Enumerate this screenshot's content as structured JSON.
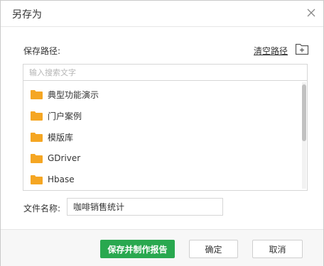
{
  "dialog": {
    "title": "另存为",
    "close_icon": "close-icon"
  },
  "path": {
    "label": "保存路径:",
    "clear_link": "清空路径",
    "new_folder_icon": "new-folder-icon"
  },
  "search": {
    "placeholder": "输入搜索文字",
    "value": ""
  },
  "folders": [
    {
      "label": "典型功能演示",
      "icon": "folder-icon"
    },
    {
      "label": "门户案例",
      "icon": "folder-icon"
    },
    {
      "label": "模版库",
      "icon": "folder-icon"
    },
    {
      "label": "GDriver",
      "icon": "folder-icon"
    },
    {
      "label": "Hbase",
      "icon": "folder-icon"
    }
  ],
  "filename": {
    "label": "文件名称:",
    "value": "咖啡销售统计"
  },
  "buttons": {
    "save_report": "保存并制作报告",
    "ok": "确定",
    "cancel": "取消"
  },
  "colors": {
    "primary": "#29a84f",
    "folder": "#f5a623"
  }
}
